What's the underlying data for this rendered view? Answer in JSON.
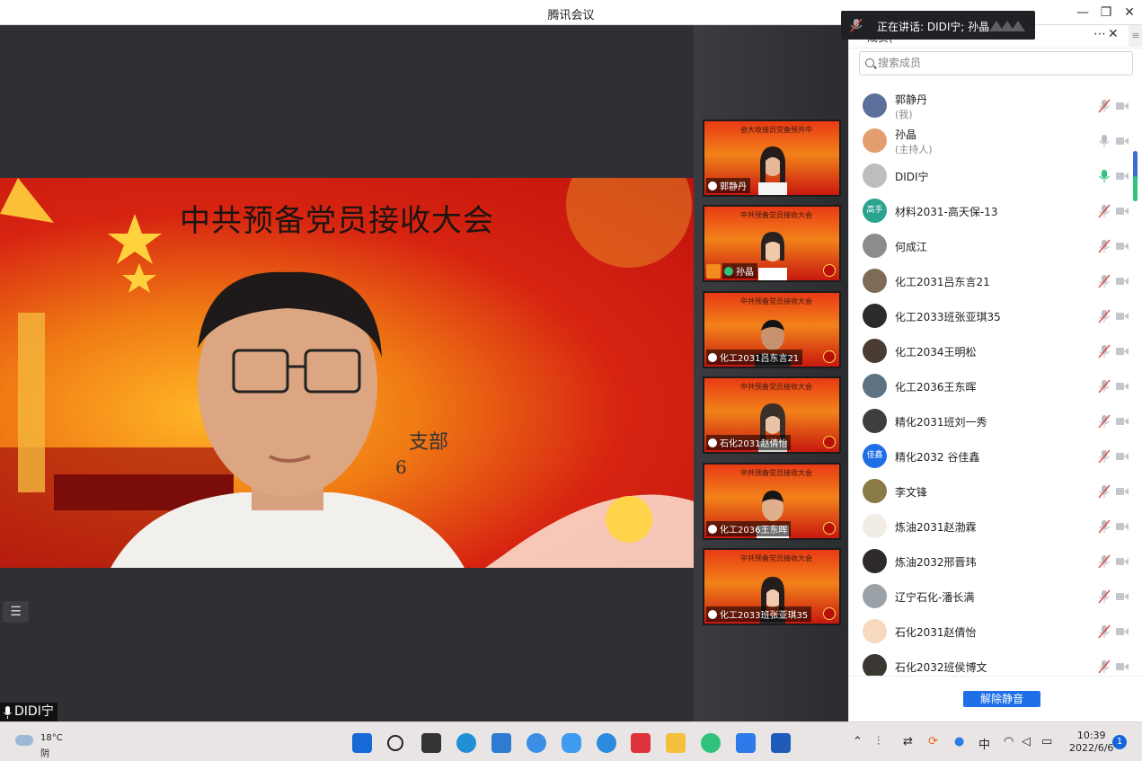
{
  "window": {
    "title": "腾讯会议"
  },
  "main_video": {
    "banner_text": "中共预备党员接收大会",
    "partial_text_1": "支部",
    "partial_text_2": "6",
    "speaker_label": "DIDI宁"
  },
  "speaking_toast": {
    "text": "正在讲话: DIDI宁; 孙晶"
  },
  "thumbnails": [
    {
      "name": "郭静丹",
      "banner": "会大收接员党备预共中",
      "host": false
    },
    {
      "name": "孙晶",
      "banner": "中共预备党员接收大会",
      "host": true
    },
    {
      "name": "化工2031吕东言21",
      "banner": "中共预备党员接收大会",
      "host": false
    },
    {
      "name": "石化2031赵倩怡",
      "banner": "中共预备党员接收大会",
      "host": false
    },
    {
      "name": "化工2036王东晖",
      "banner": "中共预备党员接收大会",
      "host": false
    },
    {
      "name": "化工2033班张亚琪35",
      "banner": "中共预备党员接收大会",
      "host": false
    }
  ],
  "panel": {
    "title": "成员(",
    "search_placeholder": "搜索成员",
    "members": [
      {
        "name": "郭静丹",
        "role": "(我)",
        "mic": "muted",
        "avatar_color": "#5a6f9a"
      },
      {
        "name": "孙晶",
        "role": "(主持人)",
        "mic": "off",
        "avatar_color": "#e39d6f"
      },
      {
        "name": "DIDI宁",
        "role": "",
        "mic": "on",
        "avatar_color": "#bdbdbd"
      },
      {
        "name": "材料2031-高天保-13",
        "role": "",
        "mic": "muted",
        "avatar_color": "#2aa38f",
        "avatar_text": "高手"
      },
      {
        "name": "何成江",
        "role": "",
        "mic": "muted",
        "avatar_color": "#8c8c8c"
      },
      {
        "name": "化工2031吕东言21",
        "role": "",
        "mic": "muted",
        "avatar_color": "#7d6b55"
      },
      {
        "name": "化工2033班张亚琪35",
        "role": "",
        "mic": "muted",
        "avatar_color": "#2b2b2b"
      },
      {
        "name": "化工2034王明松",
        "role": "",
        "mic": "muted",
        "avatar_color": "#4a3c33"
      },
      {
        "name": "化工2036王东晖",
        "role": "",
        "mic": "muted",
        "avatar_color": "#5d7381"
      },
      {
        "name": "精化2031班刘一秀",
        "role": "",
        "mic": "muted",
        "avatar_color": "#3e3e3e"
      },
      {
        "name": "精化2032 谷佳鑫",
        "role": "",
        "mic": "muted",
        "avatar_color": "#1d6fe6",
        "avatar_text": "佳鑫"
      },
      {
        "name": "李文锋",
        "role": "",
        "mic": "muted",
        "avatar_color": "#8a7a45"
      },
      {
        "name": "炼油2031赵渤霖",
        "role": "",
        "mic": "muted",
        "avatar_color": "#f1ede4"
      },
      {
        "name": "炼油2032邢晋玮",
        "role": "",
        "mic": "muted",
        "avatar_color": "#2f2a2a"
      },
      {
        "name": "辽宁石化-潘长满",
        "role": "",
        "mic": "muted",
        "avatar_color": "#9aa2a8"
      },
      {
        "name": "石化2031赵倩怡",
        "role": "",
        "mic": "muted",
        "avatar_color": "#f6d9bf"
      },
      {
        "name": "石化2032班侯博文",
        "role": "",
        "mic": "muted",
        "avatar_color": "#3b3732"
      }
    ],
    "unmute_label": "解除静音"
  },
  "taskbar": {
    "weather_temp": "18°C",
    "weather_desc": "阴",
    "time": "10:39",
    "date": "2022/6/6",
    "ime": "中",
    "notification_count": "1"
  },
  "colors": {
    "accent": "#1e6fe8",
    "mic_on": "#2ec27a",
    "mic_muted": "#e04c4c"
  }
}
